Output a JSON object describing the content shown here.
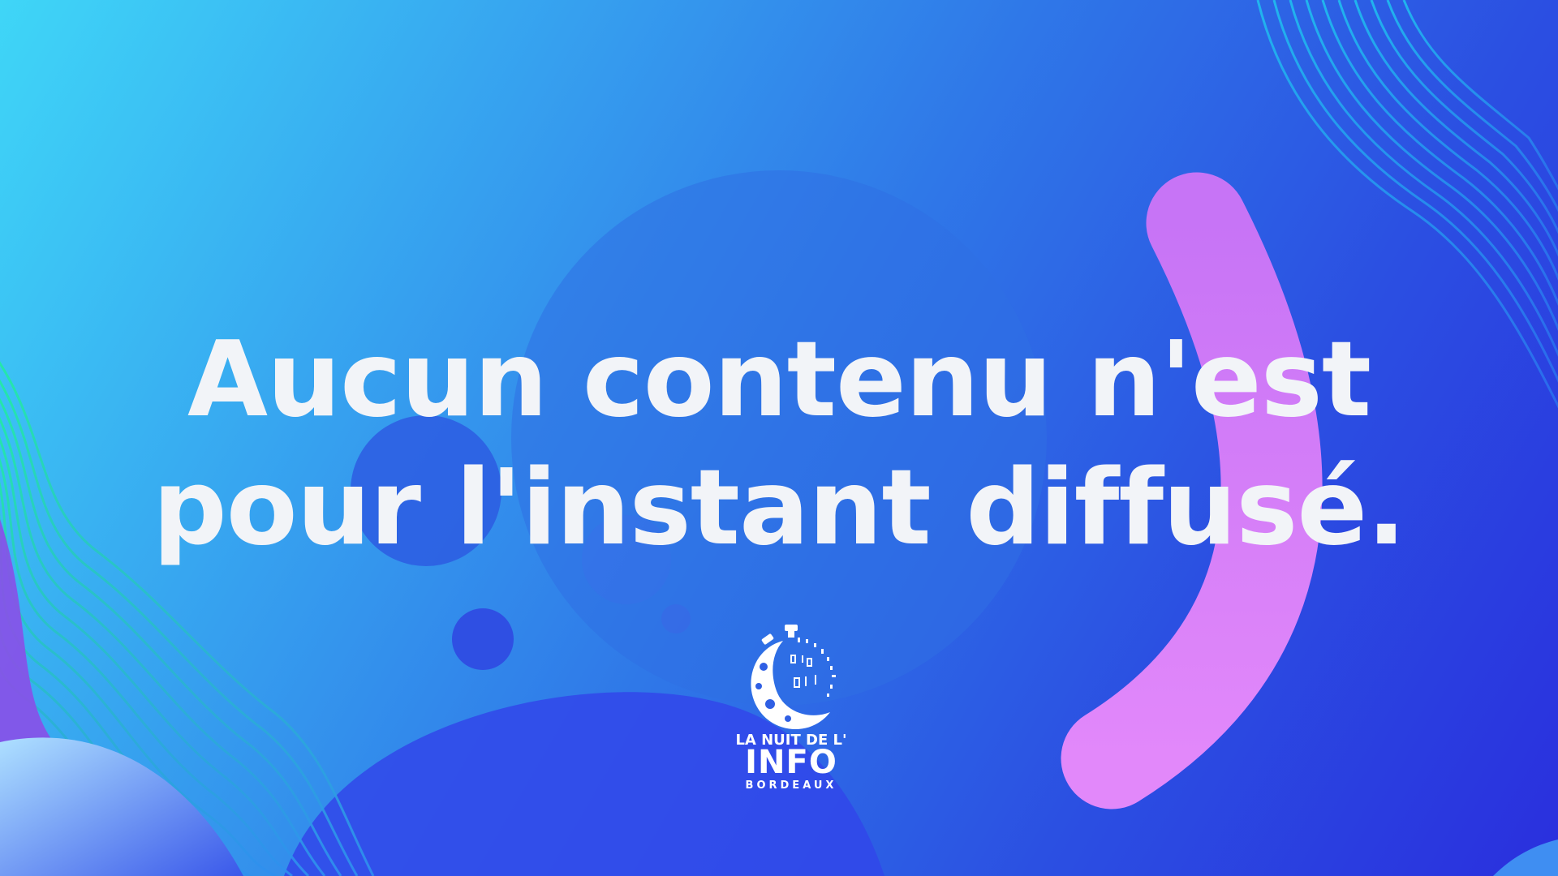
{
  "screen": {
    "message_line1": "Aucun contenu n'est",
    "message_line2": "pour l'instant diffusé."
  },
  "logo": {
    "line1": "LA NUIT DE L'",
    "line2": "INFO",
    "line3": "BORDEAUX"
  },
  "colors": {
    "background_start": "#3fd6f7",
    "background_end": "#2a2fde",
    "arc": "#d77ef7",
    "text": "#f2f4f8"
  }
}
